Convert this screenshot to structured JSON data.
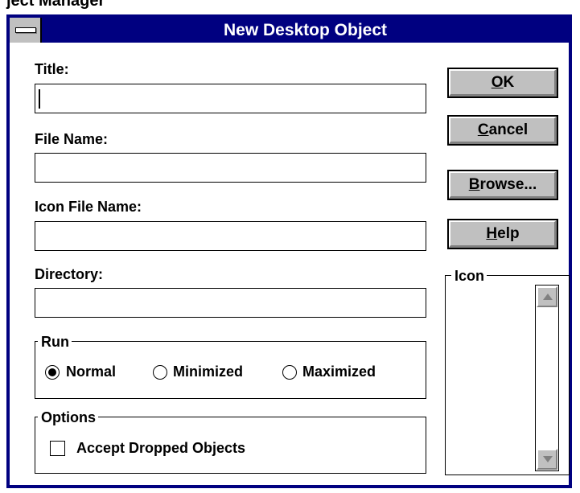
{
  "background_caption": "ject Manager",
  "window": {
    "title": "New Desktop Object",
    "system_menu_icon": "system-menu-bar"
  },
  "fields": {
    "title_label": "Title:",
    "title_value": "",
    "file_name_label": "File Name:",
    "file_name_value": "",
    "icon_file_name_label": "Icon File Name:",
    "icon_file_name_value": "",
    "directory_label": "Directory:",
    "directory_value": ""
  },
  "buttons": {
    "ok": {
      "mnemonic": "O",
      "rest": "K"
    },
    "cancel": {
      "mnemonic": "C",
      "rest": "ancel"
    },
    "browse": {
      "mnemonic": "B",
      "rest": "rowse..."
    },
    "help": {
      "mnemonic": "H",
      "rest": "elp"
    }
  },
  "run": {
    "legend": "Run",
    "options": [
      "Normal",
      "Minimized",
      "Maximized"
    ],
    "selected": "Normal"
  },
  "options": {
    "legend": "Options",
    "accept_dropped_objects_label": "Accept Dropped Objects",
    "accept_dropped_objects_checked": false
  },
  "icon_group": {
    "legend": "Icon",
    "scroll_up_icon": "scroll-up-arrow",
    "scroll_down_icon": "scroll-down-arrow"
  },
  "colors": {
    "titlebar": "#000080",
    "button_face": "#c0c0c0",
    "disabled_arrow": "#808080"
  }
}
